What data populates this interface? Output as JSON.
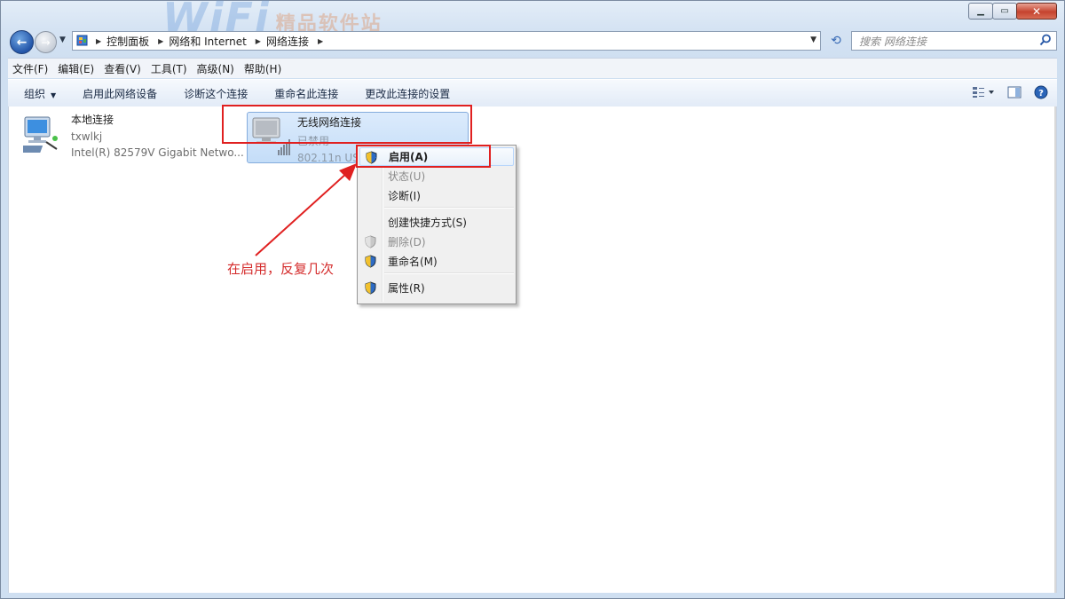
{
  "titlebar": {
    "watermark": "WiFi",
    "watermark_sub": "精品软件站",
    "minimize_icon": "minimize-icon",
    "maximize_icon": "maximize-icon",
    "close_icon": "close-icon"
  },
  "address": {
    "crumbs": [
      "控制面板",
      "网络和 Internet",
      "网络连接"
    ],
    "search_placeholder": "搜索 网络连接"
  },
  "menubar": {
    "items": [
      "文件(F)",
      "编辑(E)",
      "查看(V)",
      "工具(T)",
      "高级(N)",
      "帮助(H)"
    ]
  },
  "commandbar": {
    "items": [
      "组织",
      "启用此网络设备",
      "诊断这个连接",
      "重命名此连接",
      "更改此连接的设置"
    ]
  },
  "connections": [
    {
      "name": "本地连接",
      "status": "txwlkj",
      "device": "Intel(R) 82579V Gigabit Netwo..."
    },
    {
      "name": "无线网络连接",
      "status": "已禁用",
      "device": "802.11n USB"
    }
  ],
  "context_menu": {
    "items": [
      {
        "label": "启用(A)",
        "enabled": true,
        "default": true,
        "shield": true
      },
      {
        "label": "状态(U)",
        "enabled": false,
        "shield": false
      },
      {
        "label": "诊断(I)",
        "enabled": true,
        "shield": false
      },
      {
        "label": "创建快捷方式(S)",
        "enabled": true,
        "shield": false
      },
      {
        "label": "删除(D)",
        "enabled": false,
        "shield": true
      },
      {
        "label": "重命名(M)",
        "enabled": true,
        "shield": true
      },
      {
        "label": "属性(R)",
        "enabled": true,
        "shield": true
      }
    ]
  },
  "annotation": {
    "text": "在启用，反复几次",
    "color": "#d42b2b"
  },
  "colors": {
    "highlight_box": "#e02020",
    "selection": "#c4ddf8"
  }
}
